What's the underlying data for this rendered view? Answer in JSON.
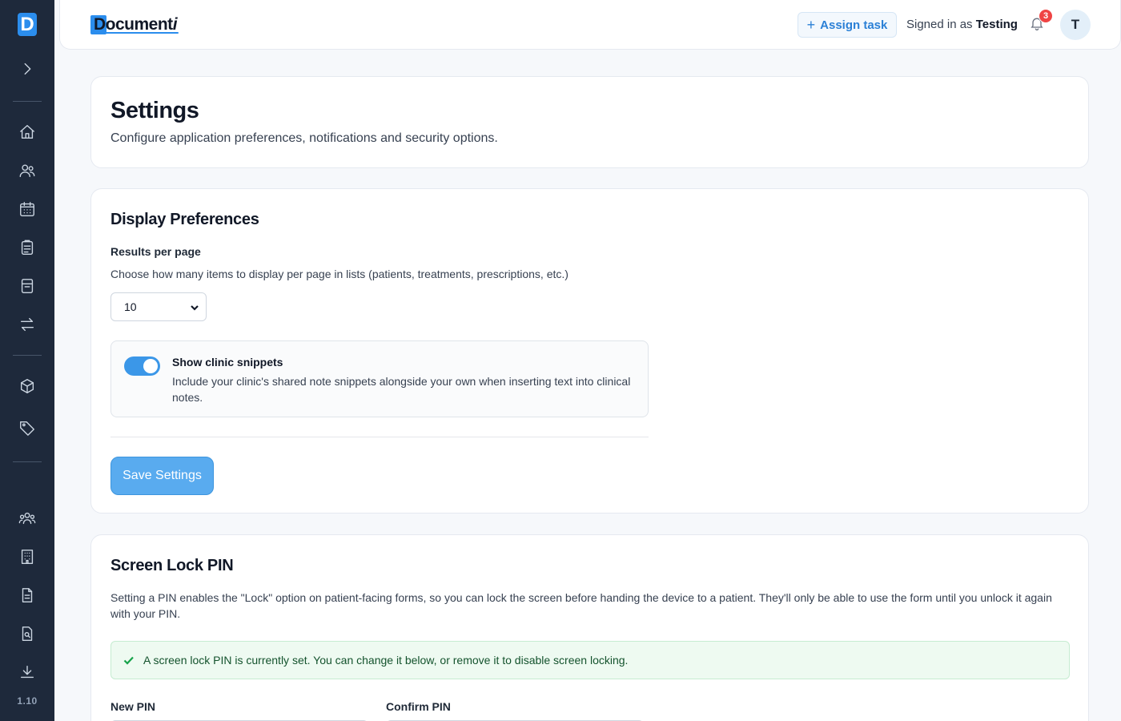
{
  "sidebar": {
    "logo_letter": "D",
    "version": "1.10",
    "icons": [
      "expand-icon",
      "home-icon",
      "users-icon",
      "calendar-icon",
      "clipboard-icon",
      "notebook-icon",
      "transfer-icon",
      "box-icon",
      "tag-icon",
      "team-icon",
      "building-icon",
      "document-icon",
      "search-document-icon",
      "download-icon"
    ]
  },
  "header": {
    "brand": "Document",
    "brand_suffix": "i",
    "assign_task": "Assign task",
    "signed_in_prefix": "Signed in as",
    "user_name": "Testing",
    "notification_count": "3",
    "avatar_initial": "T"
  },
  "page": {
    "title": "Settings",
    "subtitle": "Configure application preferences, notifications and security options."
  },
  "display": {
    "title": "Display Preferences",
    "results_label": "Results per page",
    "results_help": "Choose how many items to display per page in lists (patients, treatments, prescriptions, etc.)",
    "results_value": "10",
    "snippets_title": "Show clinic snippets",
    "snippets_desc": "Include your clinic's shared note snippets alongside your own when inserting text into clinical notes.",
    "snippets_enabled": true,
    "save_label": "Save Settings"
  },
  "pin": {
    "title": "Screen Lock PIN",
    "description": "Setting a PIN enables the \"Lock\" option on patient-facing forms, so you can lock the screen before handing the device to a patient. They'll only be able to use the form until you unlock it again with your PIN.",
    "alert": "A screen lock PIN is currently set. You can change it below, or remove it to disable screen locking.",
    "new_label": "New PIN",
    "confirm_label": "Confirm PIN"
  },
  "colors": {
    "sidebar_bg": "#1e293b",
    "accent": "#2b8ded",
    "save_button": "#59abef",
    "success_bg": "#eefaf1",
    "badge": "#ef4444"
  }
}
